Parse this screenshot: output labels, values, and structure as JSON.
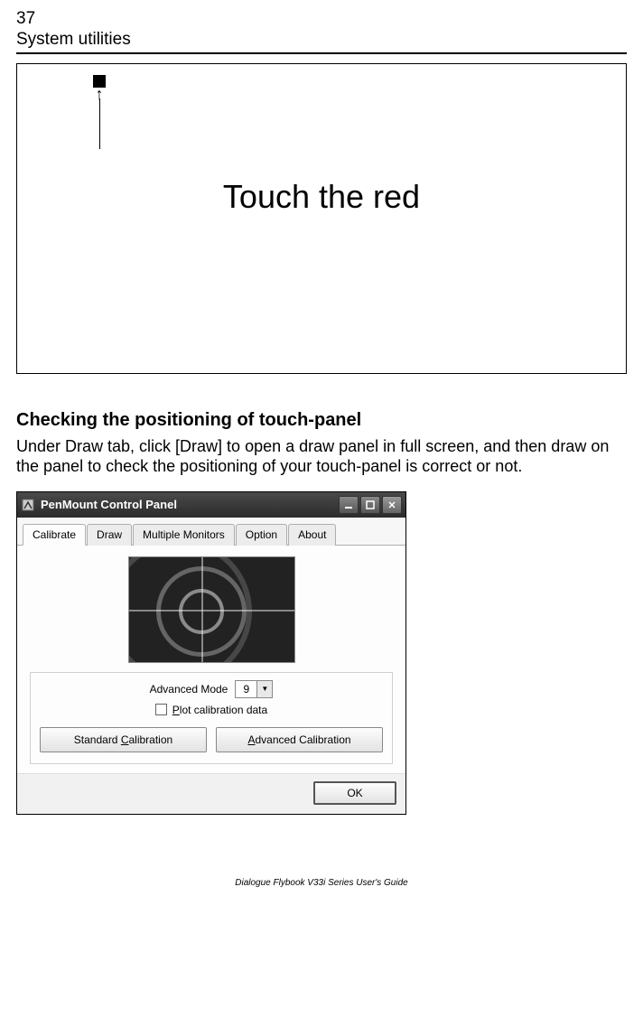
{
  "page": {
    "number": "37",
    "section": "System utilities",
    "footer": "Dialogue Flybook V33i Series User's Guide"
  },
  "calibration": {
    "instruction": "Touch the red"
  },
  "subsection": {
    "heading": "Checking the positioning of touch-panel",
    "body": "Under Draw tab, click [Draw] to open a draw panel in full screen, and then draw on the panel to check the positioning of your touch-panel is correct or not."
  },
  "dialog": {
    "title": "PenMount Control Panel",
    "tabs": [
      "Calibrate",
      "Draw",
      "Multiple Monitors",
      "Option",
      "About"
    ],
    "active_tab": 0,
    "advanced_mode_label": "Advanced Mode",
    "advanced_mode_value": "9",
    "plot_label_pre": "P",
    "plot_label_rest": "lot calibration data",
    "std_btn_pre": "Standard ",
    "std_btn_accel": "C",
    "std_btn_post": "alibration",
    "adv_btn_accel": "A",
    "adv_btn_post": "dvanced Calibration",
    "ok": "OK"
  }
}
